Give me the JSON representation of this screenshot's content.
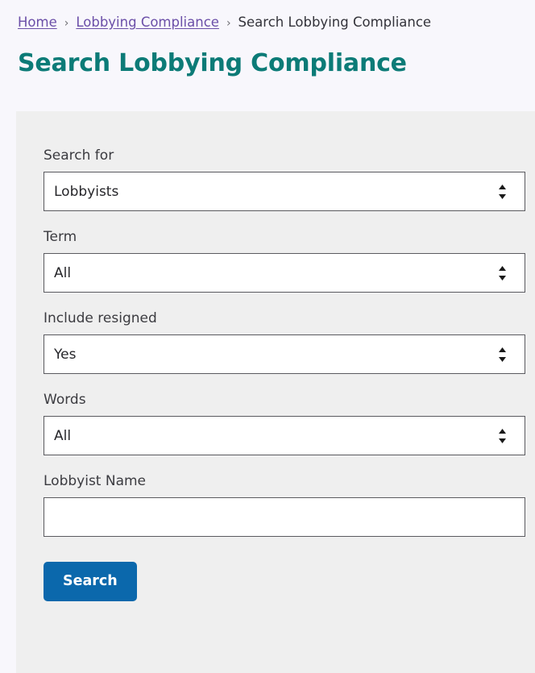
{
  "breadcrumb": {
    "separator": "›",
    "items": [
      {
        "label": "Home",
        "link": true
      },
      {
        "label": "Lobbying Compliance",
        "link": true
      },
      {
        "label": "Search Lobbying Compliance",
        "link": false
      }
    ]
  },
  "page": {
    "title": "Search Lobbying Compliance",
    "title_color": "#0c7b77",
    "background_color": "#f8f7fc",
    "panel_color": "#efefef"
  },
  "form": {
    "fields": [
      {
        "name": "search-for",
        "label": "Search for",
        "type": "select",
        "value": "Lobbyists",
        "options": [
          "Lobbyists"
        ]
      },
      {
        "name": "term",
        "label": "Term",
        "type": "select",
        "value": "All",
        "options": [
          "All"
        ]
      },
      {
        "name": "include-resigned",
        "label": "Include resigned",
        "type": "select",
        "value": "Yes",
        "options": [
          "Yes"
        ]
      },
      {
        "name": "words",
        "label": "Words",
        "type": "select",
        "value": "All",
        "options": [
          "All"
        ]
      },
      {
        "name": "lobbyist-name",
        "label": "Lobbyist Name",
        "type": "text",
        "value": "",
        "placeholder": ""
      }
    ],
    "submit": {
      "label": "Search",
      "color": "#0b68ac",
      "text_color": "#ffffff"
    }
  }
}
